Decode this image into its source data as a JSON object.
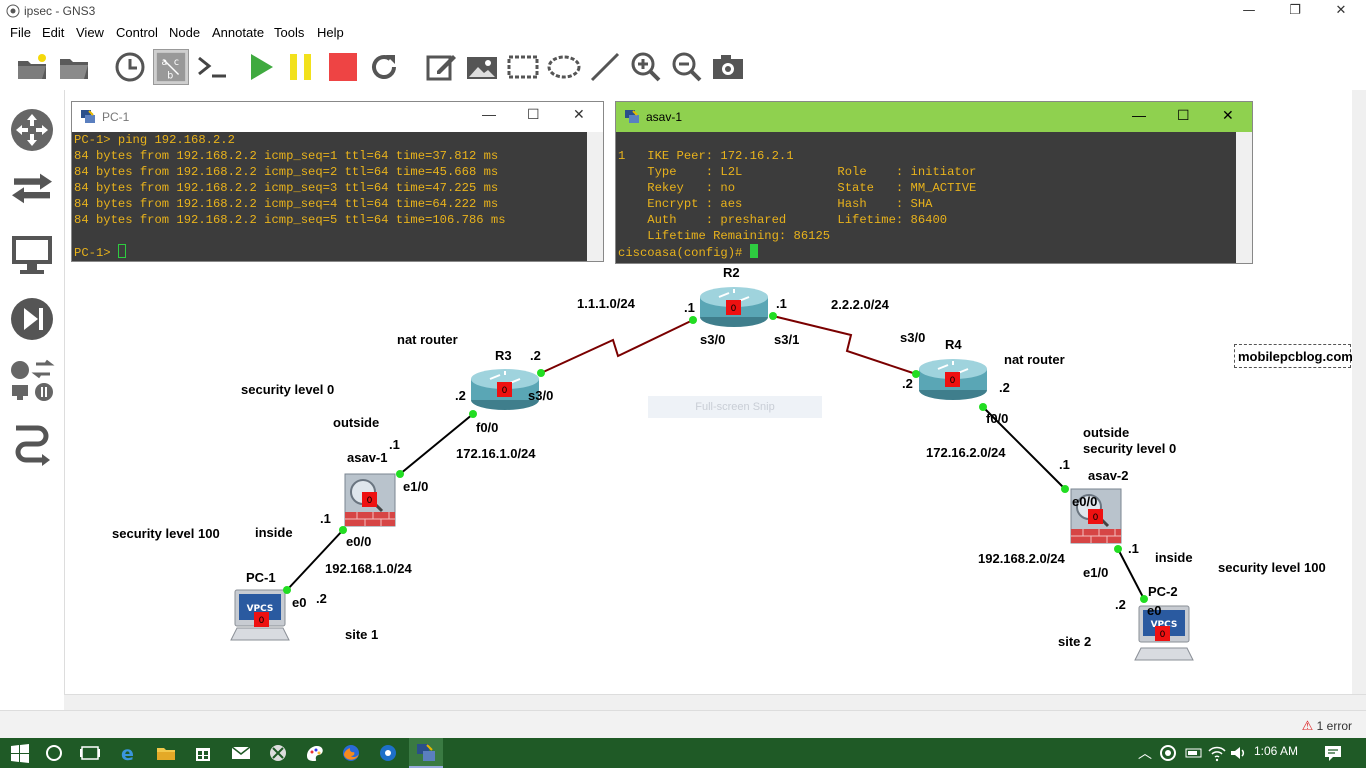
{
  "window": {
    "title": "ipsec - GNS3",
    "minimize": "—",
    "restore": "❐",
    "close": "✕"
  },
  "menu": [
    "File",
    "Edit",
    "View",
    "Control",
    "Node",
    "Annotate",
    "Tools",
    "Help"
  ],
  "toolbar": [
    "open-project-icon",
    "folder-icon",
    "snapshot-clock-icon",
    "show-interface-labels-icon",
    "console-all-icon",
    "start-all-icon",
    "suspend-all-icon",
    "stop-all-icon",
    "reload-all-icon",
    "add-note-icon",
    "insert-picture-icon",
    "draw-rectangle-icon",
    "draw-ellipse-icon",
    "draw-line-icon",
    "zoom-in-icon",
    "zoom-out-icon",
    "screenshot-icon"
  ],
  "dock": [
    "routers-icon",
    "switches-icon",
    "end-devices-icon",
    "security-devices-icon",
    "all-devices-icon",
    "add-link-icon"
  ],
  "pc1_console": {
    "title": "PC-1",
    "lines": [
      "PC-1> ping 192.168.2.2",
      "84 bytes from 192.168.2.2 icmp_seq=1 ttl=64 time=37.812 ms",
      "84 bytes from 192.168.2.2 icmp_seq=2 ttl=64 time=45.668 ms",
      "84 bytes from 192.168.2.2 icmp_seq=3 ttl=64 time=47.225 ms",
      "84 bytes from 192.168.2.2 icmp_seq=4 ttl=64 time=64.222 ms",
      "84 bytes from 192.168.2.2 icmp_seq=5 ttl=64 time=106.786 ms",
      "",
      "PC-1> "
    ]
  },
  "asav1_console": {
    "title": "asav-1",
    "lines": [
      "",
      "1   IKE Peer: 172.16.2.1",
      "    Type    : L2L             Role    : initiator",
      "    Rekey   : no              State   : MM_ACTIVE",
      "    Encrypt : aes             Hash    : SHA",
      "    Auth    : preshared       Lifetime: 86400",
      "    Lifetime Remaining: 86125",
      "ciscoasa(config)# "
    ]
  },
  "labels": {
    "r2": "R2",
    "r3": "R3",
    "r4": "R4",
    "asav1": "asav-1",
    "asav2": "asav-2",
    "pc1": "PC-1",
    "pc2": "PC-2",
    "net_r3_r2": "1.1.1.0/24",
    "net_r2_r4": "2.2.2.0/24",
    "r2_left_ip": ".1",
    "r2_right_ip": ".1",
    "r2_s30": "s3/0",
    "r2_s31": "s3/1",
    "r3_nat": "nat router",
    "r3_ip2": ".2",
    "r3_s30": "s3/0",
    "r3_f0ip": ".2",
    "r3_f00": "f0/0",
    "r4_s30": "s3/0",
    "r4_nat": "nat router",
    "r4_ip2": ".2",
    "r4_f0ip": ".2",
    "r4_f00": "f0/0",
    "net_172_1": "172.16.1.0/24",
    "net_172_2": "172.16.2.0/24",
    "sec0_left": "security level 0",
    "outside_left": "outside",
    "asav1_e1ip": ".1",
    "asav1_e10": "e1/0",
    "asav1_e0ip": ".1",
    "asav1_e00": "e0/0",
    "inside_left": "inside",
    "sec100_left": "security level 100",
    "net_192_1": "192.168.1.0/24",
    "pc1_e0": "e0",
    "pc1_ip": ".2",
    "site1": "site 1",
    "outside_right": "outside",
    "sec0_right": "security level 0",
    "asav2_e0ip": ".1",
    "asav2_e00": "e0/0",
    "net_192_2": "192.168.2.0/24",
    "asav2_e1ip": ".1",
    "asav2_e10": "e1/0",
    "inside_right": "inside",
    "sec100_right": "security level 100",
    "pc2_ip": ".2",
    "pc2_e0": "e0",
    "site2": "site 2",
    "watermark": "mobilepcblog.com",
    "fullscreen_snip": "Full-screen Snip"
  },
  "status": {
    "error": "1 error"
  },
  "taskbar": {
    "time": "1:06 AM"
  },
  "colors": {
    "taskbar": "#1f5a26",
    "console_text": "#e8b21c",
    "asav_console_header": "#8fd14f",
    "link_port": "#22dd22",
    "serial_link": "#7a0000"
  }
}
